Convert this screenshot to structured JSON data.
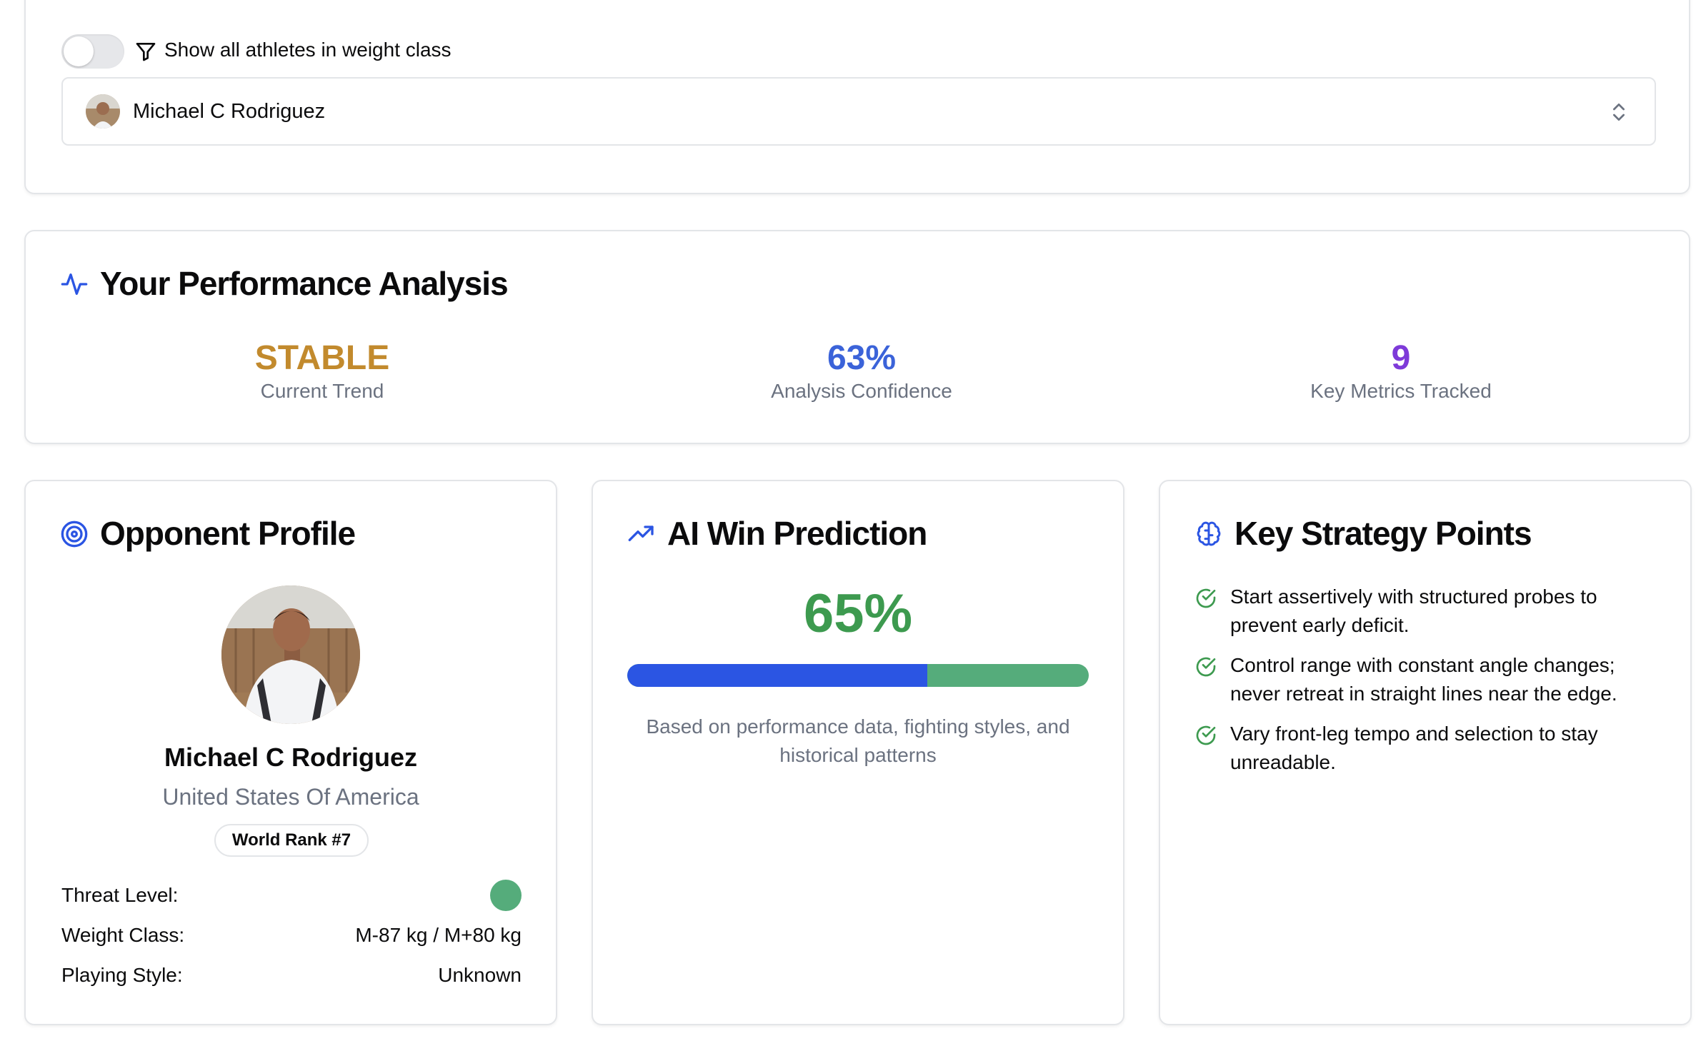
{
  "selector": {
    "toggle_label": "Show all athletes in weight class",
    "toggle_on": false,
    "selected_athlete": "Michael C Rodriguez"
  },
  "performance": {
    "title": "Your Performance Analysis",
    "stats": [
      {
        "value": "STABLE",
        "label": "Current Trend",
        "color": "#c28a2d"
      },
      {
        "value": "63%",
        "label": "Analysis Confidence",
        "color": "#3b63d9"
      },
      {
        "value": "9",
        "label": "Key Metrics Tracked",
        "color": "#7e3ad9"
      }
    ]
  },
  "opponent": {
    "title": "Opponent Profile",
    "name": "Michael C Rodriguez",
    "country": "United States Of America",
    "rank_badge": "World Rank #7",
    "threat_label": "Threat Level:",
    "threat_color": "#55ac7b",
    "weight_label": "Weight Class:",
    "weight_value": "M-87 kg / M+80 kg",
    "style_label": "Playing Style:",
    "style_value": "Unknown"
  },
  "prediction": {
    "title": "AI Win Prediction",
    "value": "65%",
    "bar_fraction": 0.65,
    "note": "Based on performance data, fighting styles, and historical patterns"
  },
  "strategy": {
    "title": "Key Strategy Points",
    "points": [
      "Start assertively with structured probes to prevent early deficit.",
      "Control range with constant angle changes; never retreat in straight lines near the edge.",
      "Vary front-leg tempo and selection to stay unreadable."
    ]
  },
  "colors": {
    "accent_blue": "#2b55e3",
    "success_green": "#3d9a4f",
    "muted_text": "#6b7280"
  },
  "icons": [
    "filter-icon",
    "chevron-up-down-icon",
    "activity-icon",
    "target-icon",
    "trending-up-icon",
    "brain-icon",
    "check-circle-icon"
  ]
}
